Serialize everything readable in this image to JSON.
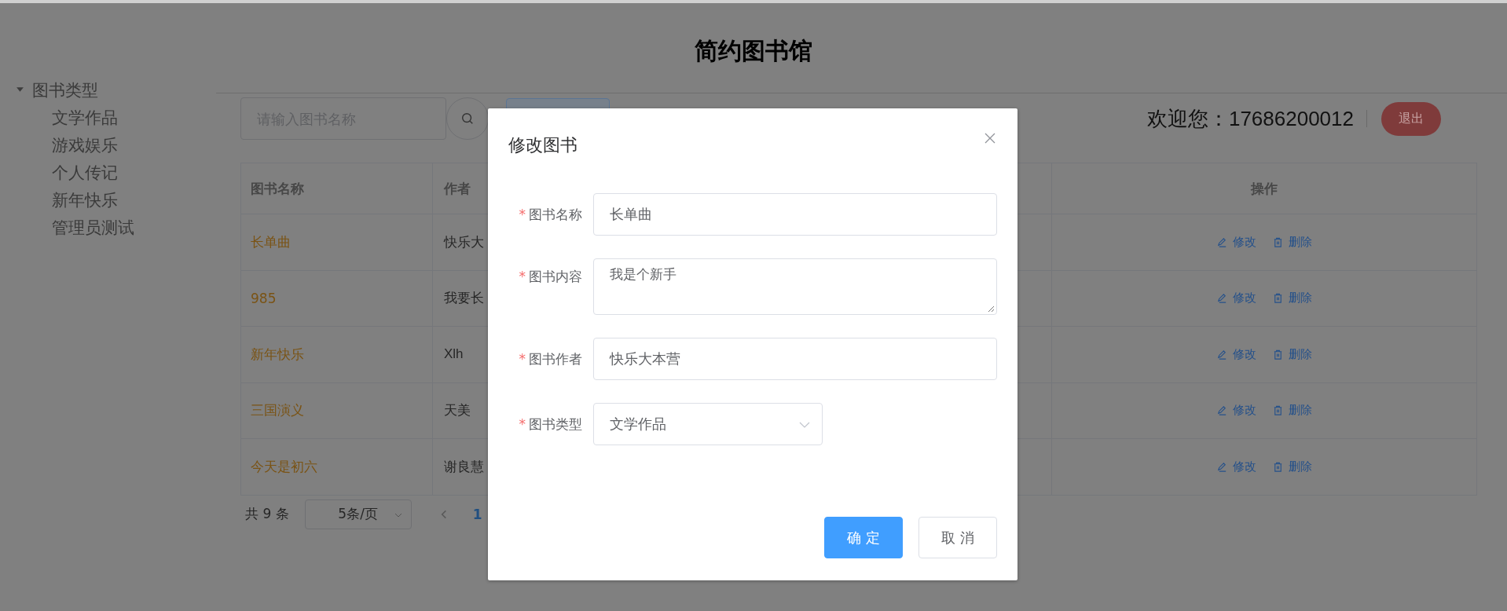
{
  "header": {
    "title": "简约图书馆"
  },
  "sidebar": {
    "tree": [
      {
        "label": "图书类型",
        "expanded": true,
        "children": [
          {
            "label": "文学作品"
          },
          {
            "label": "游戏娱乐"
          },
          {
            "label": "个人传记"
          },
          {
            "label": "新年快乐"
          },
          {
            "label": "管理员测试"
          }
        ]
      }
    ]
  },
  "toolbar": {
    "search": {
      "placeholder": "请输入图书名称"
    }
  },
  "user": {
    "greeting": "欢迎您：",
    "account": "17686200012",
    "logout": "退出"
  },
  "table": {
    "columns": [
      {
        "label": "图书名称",
        "kind": "name"
      },
      {
        "label": "作者",
        "kind": "author"
      },
      {
        "label": "操作",
        "kind": "actions"
      }
    ],
    "rows": [
      {
        "name": "长单曲",
        "author": "快乐大",
        "actions": [
          {
            "label": "修改",
            "kind": "edit"
          },
          {
            "label": "删除",
            "kind": "delete"
          }
        ]
      },
      {
        "name": "985",
        "author": "我要长",
        "actions": [
          {
            "label": "修改",
            "kind": "edit"
          },
          {
            "label": "删除",
            "kind": "delete"
          }
        ]
      },
      {
        "name": "新年快乐",
        "author": "Xlh",
        "actions": [
          {
            "label": "修改",
            "kind": "edit"
          },
          {
            "label": "删除",
            "kind": "delete"
          }
        ]
      },
      {
        "name": "三国演义",
        "author": "天美",
        "actions": [
          {
            "label": "修改",
            "kind": "edit"
          },
          {
            "label": "删除",
            "kind": "delete"
          }
        ]
      },
      {
        "name": "今天是初六",
        "author": "谢良慧",
        "actions": [
          {
            "label": "修改",
            "kind": "edit"
          },
          {
            "label": "删除",
            "kind": "delete"
          }
        ]
      }
    ]
  },
  "pagination": {
    "total": "共 9 条",
    "page_size": "5条/页",
    "pages": [
      {
        "label": "1",
        "selected": true
      }
    ]
  },
  "dialog": {
    "title": "修改图书",
    "fields": [
      {
        "kind": "input",
        "required_mark": "*",
        "label": "图书名称",
        "value": "长单曲"
      },
      {
        "kind": "textarea",
        "required_mark": "*",
        "label": "图书内容",
        "value": "我是个新手"
      },
      {
        "kind": "input",
        "required_mark": "*",
        "label": "图书作者",
        "value": "快乐大本营"
      },
      {
        "kind": "select",
        "required_mark": "*",
        "label": "图书类型",
        "value": "文学作品"
      }
    ],
    "buttons": [
      {
        "label": "确 定",
        "kind": "primary"
      },
      {
        "label": "取 消",
        "kind": "default"
      }
    ]
  }
}
